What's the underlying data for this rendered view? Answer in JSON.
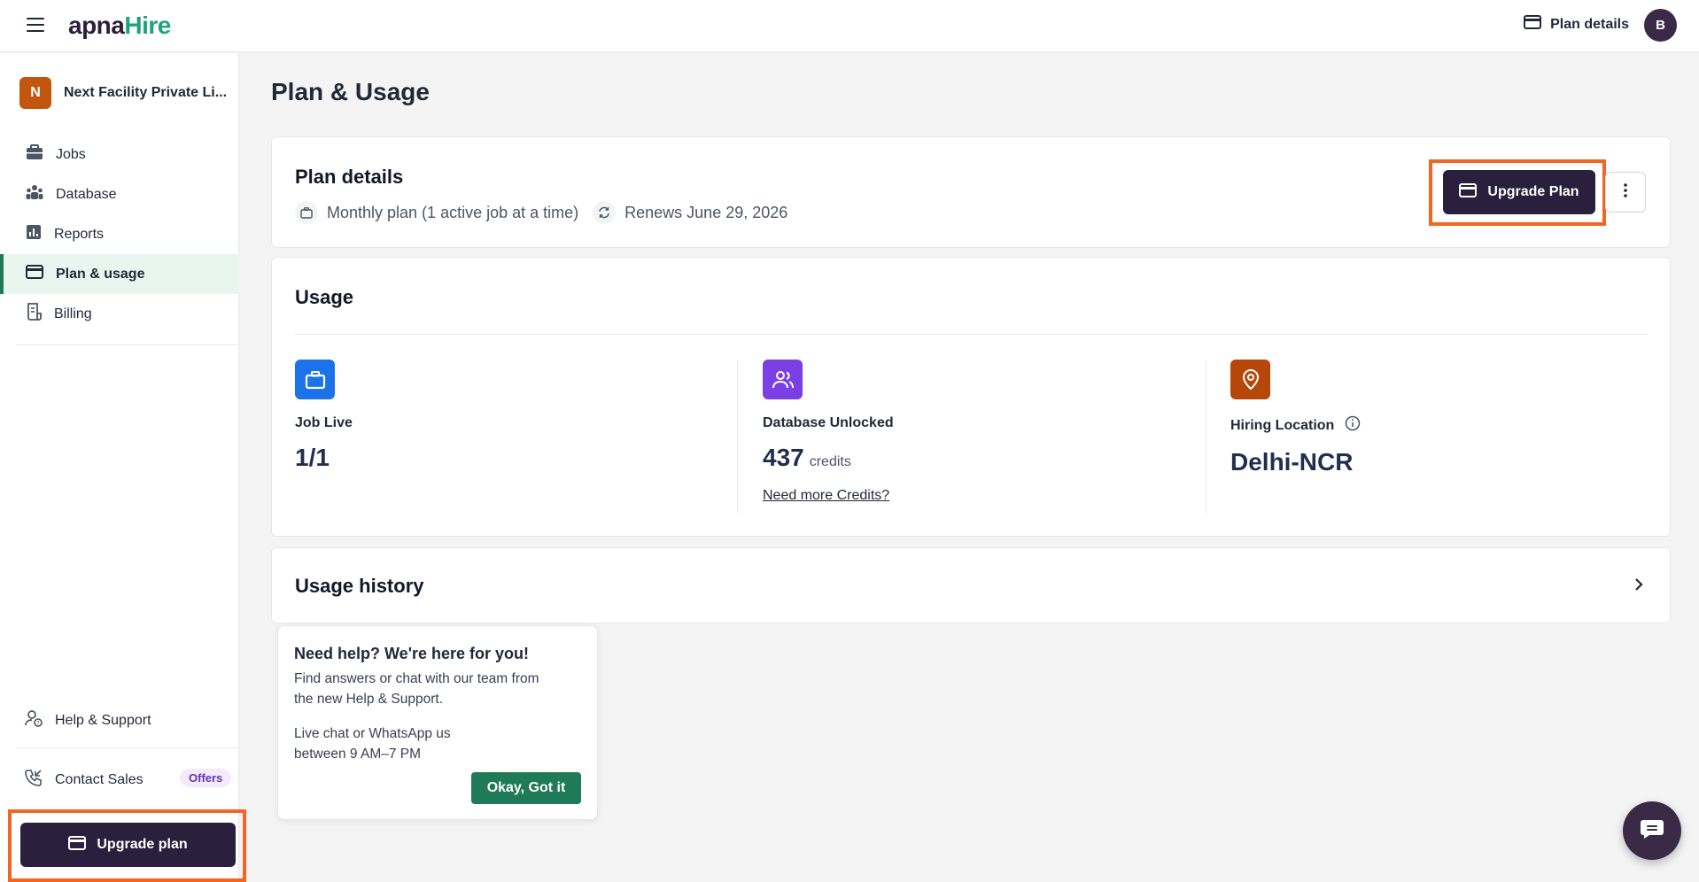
{
  "header": {
    "logo_part1": "apna",
    "logo_part2": "Hire",
    "plan_details_label": "Plan details",
    "avatar_initial": "B"
  },
  "sidebar": {
    "company_initial": "N",
    "company_name": "Next Facility Private Li...",
    "items": [
      {
        "label": "Jobs",
        "icon": "briefcase-icon"
      },
      {
        "label": "Database",
        "icon": "people-icon"
      },
      {
        "label": "Reports",
        "icon": "bar-chart-icon"
      },
      {
        "label": "Plan & usage",
        "icon": "credit-card-icon",
        "active": true
      },
      {
        "label": "Billing",
        "icon": "receipt-icon"
      }
    ],
    "help_support": "Help & Support",
    "contact_sales": "Contact Sales",
    "offers_badge": "Offers",
    "upgrade_label": "Upgrade plan"
  },
  "main": {
    "page_title": "Plan & Usage",
    "plan_card": {
      "title": "Plan details",
      "plan_type": "Monthly plan (1 active job at a time)",
      "renews": "Renews June 29, 2026",
      "upgrade_label": "Upgrade Plan"
    },
    "usage_card": {
      "title": "Usage",
      "metrics": [
        {
          "label": "Job Live",
          "value": "1/1",
          "icon": "briefcase-icon",
          "color": "#1a73e8"
        },
        {
          "label": "Database Unlocked",
          "value": "437",
          "unit": "credits",
          "link": "Need more Credits?",
          "icon": "people-icon",
          "color": "#7b3fe4"
        },
        {
          "label": "Hiring Location",
          "value": "Delhi-NCR",
          "icon": "location-pin-icon",
          "color": "#b54708"
        }
      ]
    },
    "history_card": {
      "title": "Usage history"
    }
  },
  "help_popup": {
    "title": "Need help? We're here for you!",
    "body": "Find answers or chat with our team from the new Help & Support.",
    "hours": "Live chat or WhatsApp us between 9 AM–7 PM",
    "ok_label": "Okay, Got it"
  },
  "colors": {
    "brand_dark": "#2a1f3d",
    "brand_green": "#1fa37a",
    "highlight_outline": "#f26522"
  }
}
